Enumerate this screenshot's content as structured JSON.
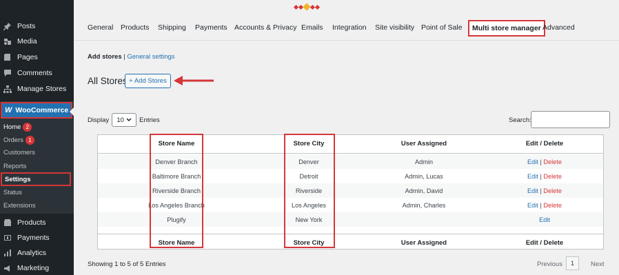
{
  "sidebar": {
    "top_items": [
      {
        "label": "Posts",
        "icon": "pin-icon"
      },
      {
        "label": "Media",
        "icon": "media-icon"
      },
      {
        "label": "Pages",
        "icon": "pages-icon"
      },
      {
        "label": "Comments",
        "icon": "comments-icon"
      },
      {
        "label": "Manage Stores",
        "icon": "stores-icon"
      }
    ],
    "woocommerce": {
      "label": "WooCommerce",
      "logo": "W"
    },
    "sub_items": {
      "home": {
        "label": "Home",
        "badge": "2"
      },
      "orders": {
        "label": "Orders",
        "badge": "1"
      },
      "customers": "Customers",
      "reports": "Reports",
      "settings": "Settings",
      "status": "Status",
      "extensions": "Extensions"
    },
    "bottom_items": [
      {
        "label": "Products",
        "icon": "products-icon"
      },
      {
        "label": "Payments",
        "icon": "payments-icon"
      },
      {
        "label": "Analytics",
        "icon": "analytics-icon"
      },
      {
        "label": "Marketing",
        "icon": "marketing-icon"
      }
    ]
  },
  "tabs": [
    "General",
    "Products",
    "Shipping",
    "Payments",
    "Accounts & Privacy",
    "Emails",
    "Integration",
    "Site visibility",
    "Point of Sale",
    "Multi store manager",
    "Advanced"
  ],
  "active_tab": "Multi store manager",
  "subnav": {
    "current": "Add stores",
    "separator": "|",
    "link": "General settings"
  },
  "page_title": "All Stores",
  "add_button": "+ Add Stores",
  "display": {
    "prefix": "Display",
    "value": "10",
    "suffix": "Entries"
  },
  "search": {
    "label": "Search:",
    "value": ""
  },
  "table": {
    "headers": [
      "Store Name",
      "Store City",
      "User Assigned",
      "Edit / Delete"
    ],
    "rows": [
      {
        "name": "Denver Branch",
        "city": "Denver",
        "user": "Admin",
        "edit": "Edit",
        "delete": "Delete"
      },
      {
        "name": "Baltimore Branch",
        "city": "Detroit",
        "user": "Admin, Lucas",
        "edit": "Edit",
        "delete": "Delete"
      },
      {
        "name": "Riverside Branch",
        "city": "Riverside",
        "user": "Admin, David",
        "edit": "Edit",
        "delete": "Delete"
      },
      {
        "name": "Los Angeles Branch",
        "city": "Los Angeles",
        "user": "Admin, Charles",
        "edit": "Edit",
        "delete": "Delete"
      },
      {
        "name": "Plugify",
        "city": "New York",
        "user": "",
        "edit": "Edit",
        "delete": ""
      }
    ],
    "link_separator": "|"
  },
  "footer": {
    "info": "Showing 1 to 5 of 5 Entries",
    "previous": "Previous",
    "page": "1",
    "next": "Next"
  },
  "colors": {
    "accent": "#2271b1",
    "highlight": "#d63638",
    "sidebar": "#1d2327"
  }
}
